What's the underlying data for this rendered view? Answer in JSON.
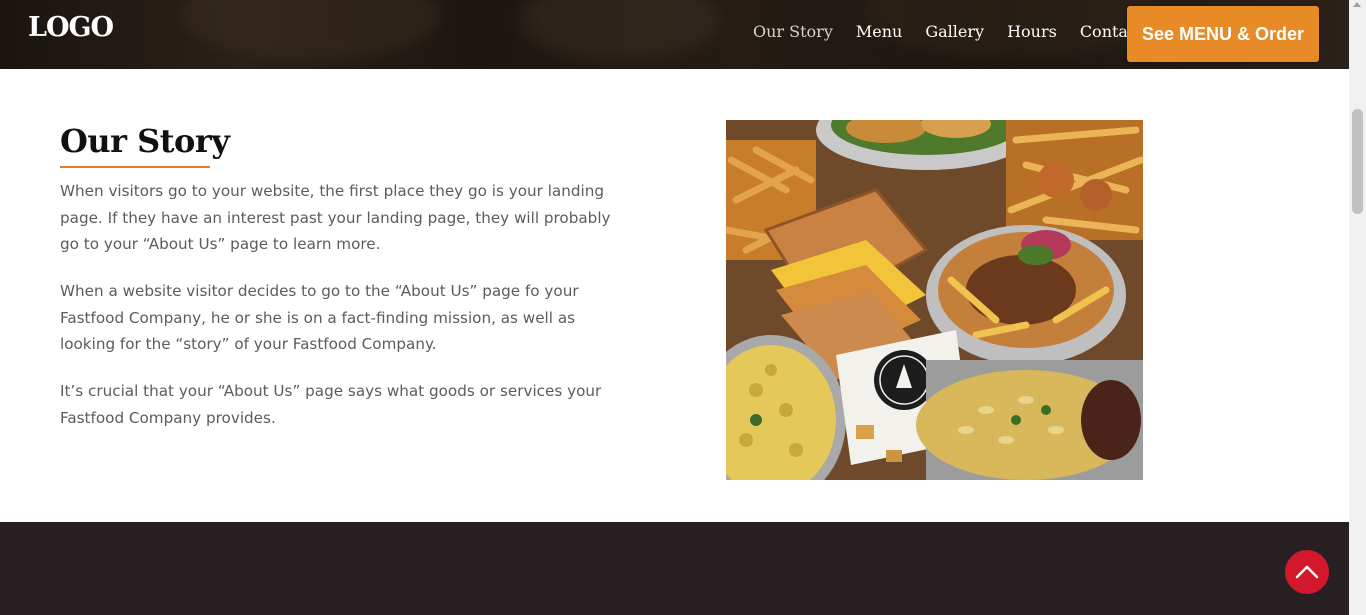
{
  "header": {
    "logo": "LOGO",
    "nav": [
      "Our Story",
      "Menu",
      "Gallery",
      "Hours",
      "Contact"
    ],
    "cta": "See MENU & Order"
  },
  "story": {
    "title": "Our Story",
    "paragraphs": [
      "When visitors go to your website, the first place they go is your landing page. If they have an interest past your landing page, they will probably go to your “About Us” page to learn more.",
      "When a website visitor decides to go to the “About Us” page fo your Fastfood Company, he or she is on a fact-finding mission, as well as looking for the “story” of your Fastfood Company.",
      "It’s crucial that your “About Us” page says what goods or services your Fastfood Company provides."
    ]
  },
  "colors": {
    "accent": "#e88a25",
    "underline": "#e07a24",
    "dark_band": "#262022",
    "back_to_top": "#d3182c"
  },
  "icons": {
    "back_to_top": "chevron-up-icon"
  }
}
